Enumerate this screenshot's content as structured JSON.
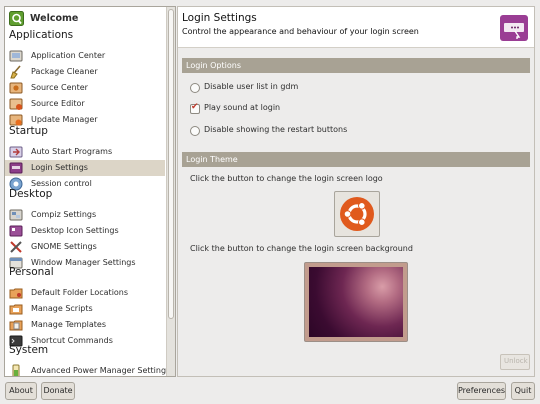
{
  "sidebar": {
    "header": "Welcome",
    "categories": [
      {
        "label": "Applications",
        "items": [
          {
            "label": "Application Center",
            "icon": "application-center-icon"
          },
          {
            "label": "Package Cleaner",
            "icon": "package-cleaner-icon"
          },
          {
            "label": "Source Center",
            "icon": "source-center-icon"
          },
          {
            "label": "Source Editor",
            "icon": "source-editor-icon"
          },
          {
            "label": "Update Manager",
            "icon": "update-manager-icon"
          }
        ]
      },
      {
        "label": "Startup",
        "items": [
          {
            "label": "Auto Start Programs",
            "icon": "auto-start-icon"
          },
          {
            "label": "Login Settings",
            "icon": "login-settings-icon",
            "selected": true
          },
          {
            "label": "Session control",
            "icon": "session-control-icon"
          }
        ]
      },
      {
        "label": "Desktop",
        "items": [
          {
            "label": "Compiz Settings",
            "icon": "compiz-settings-icon"
          },
          {
            "label": "Desktop Icon Settings",
            "icon": "desktop-icon-settings-icon"
          },
          {
            "label": "GNOME Settings",
            "icon": "gnome-settings-icon"
          },
          {
            "label": "Window Manager Settings",
            "icon": "window-manager-icon"
          }
        ]
      },
      {
        "label": "Personal",
        "items": [
          {
            "label": "Default Folder Locations",
            "icon": "folder-locations-icon"
          },
          {
            "label": "Manage Scripts",
            "icon": "scripts-icon"
          },
          {
            "label": "Manage Templates",
            "icon": "templates-icon"
          },
          {
            "label": "Shortcut Commands",
            "icon": "shortcut-commands-icon"
          }
        ]
      },
      {
        "label": "System",
        "items": [
          {
            "label": "Advanced Power Manager Settings",
            "icon": "power-manager-icon"
          }
        ]
      }
    ]
  },
  "main": {
    "title": "Login Settings",
    "subtitle": "Control the appearance and behaviour of your login screen",
    "login_options": {
      "header": "Login Options",
      "options": [
        {
          "label": "Disable user list in gdm",
          "checked": false
        },
        {
          "label": "Play sound at login",
          "checked": true
        },
        {
          "label": "Disable showing the restart buttons",
          "checked": false
        }
      ]
    },
    "login_theme": {
      "header": "Login Theme",
      "logo_hint": "Click the button to change the login screen logo",
      "background_hint": "Click the button to change the login screen background"
    },
    "unlock_label": "Unlock"
  },
  "footer": {
    "about": "About",
    "donate": "Donate",
    "preferences": "Preferences",
    "quit": "Quit"
  },
  "colors": {
    "section_header": "#a8a294",
    "selected_row": "#dcd5c7",
    "ubuntu_orange": "#e05a1d",
    "header_icon": "#9a3d94"
  }
}
